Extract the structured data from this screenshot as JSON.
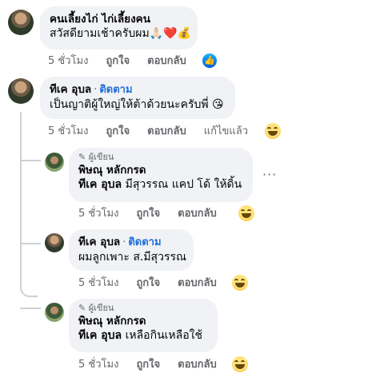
{
  "comments": [
    {
      "name": "คนเลี้ยงไก่ ไก่เลี้ยงคน",
      "text": "สวัสดียามเช้าครับผม🙏🏻❤️💰",
      "time": "5 ชั่วโมง",
      "like": "ถูกใจ",
      "reply": "ตอบกลับ",
      "reaction_icon": "like-icon"
    },
    {
      "name": "ทีเค อุบล",
      "follow": "ติดตาม",
      "text": "เป็นญาติผู้ใหญ่ให้ต้าด้วยนะครับพี่ 😘",
      "time": "5 ชั่วโมง",
      "like": "ถูกใจ",
      "reply": "ตอบกลับ",
      "edited": "แก้ไขแล้ว",
      "reaction_icon": "haha-icon"
    },
    {
      "badge": "ผู้เขียน",
      "name": "พิษณุ หลักกรด",
      "mention": "ทีเค อุบล",
      "text": " มีสุวรรณ แคป โด้ ให้ดิ้น",
      "time": "5 ชั่วโมง",
      "like": "ถูกใจ",
      "reply": "ตอบกลับ",
      "more": "···",
      "reaction_icon": "haha-icon"
    },
    {
      "name": "ทีเค อุบล",
      "follow": "ติดตาม",
      "text": "ผมลูกเพาะ ส.มีสุวรรณ",
      "time": "5 ชั่วโมง",
      "like": "ถูกใจ",
      "reply": "ตอบกลับ",
      "reaction_icon": "haha-icon"
    },
    {
      "badge": "ผู้เขียน",
      "name": "พิษณุ หลักกรด",
      "mention": "ทีเค อุบล",
      "text": " เหลือกินเหลือใช้",
      "time": "5 ชั่วโมง",
      "like": "ถูกใจ",
      "reply": "ตอบกลับ",
      "reaction_icon": "haha-icon"
    }
  ]
}
